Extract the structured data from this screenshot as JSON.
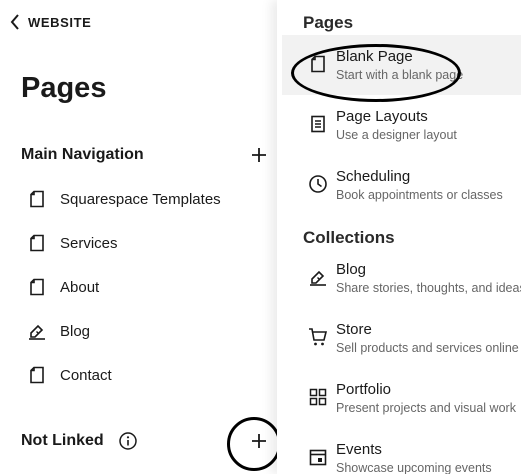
{
  "left_panel": {
    "back_label": "WEBSITE",
    "title": "Pages",
    "main_nav": {
      "label": "Main Navigation",
      "items": [
        {
          "label": "Squarespace Templates",
          "icon": "page-icon"
        },
        {
          "label": "Services",
          "icon": "page-icon"
        },
        {
          "label": "About",
          "icon": "page-icon"
        },
        {
          "label": "Blog",
          "icon": "blog-icon"
        },
        {
          "label": "Contact",
          "icon": "page-icon"
        }
      ]
    },
    "not_linked": {
      "label": "Not Linked"
    }
  },
  "right_panel": {
    "pages_title": "Pages",
    "pages": [
      {
        "title": "Blank Page",
        "desc": "Start with a blank page",
        "icon": "page-icon",
        "active": true
      },
      {
        "title": "Page Layouts",
        "desc": "Use a designer layout",
        "icon": "layout-icon"
      },
      {
        "title": "Scheduling",
        "desc": "Book appointments or classes",
        "icon": "clock-icon"
      }
    ],
    "collections_title": "Collections",
    "collections": [
      {
        "title": "Blog",
        "desc": "Share stories, thoughts, and ideas",
        "icon": "blog-icon"
      },
      {
        "title": "Store",
        "desc": "Sell products and services online",
        "icon": "cart-icon"
      },
      {
        "title": "Portfolio",
        "desc": "Present projects and visual work",
        "icon": "grid-icon"
      },
      {
        "title": "Events",
        "desc": "Showcase upcoming events",
        "icon": "calendar-icon"
      }
    ]
  },
  "colors": {
    "active_background": "#f2f2f2",
    "annotation": "#000000",
    "description_text": "#666666"
  }
}
